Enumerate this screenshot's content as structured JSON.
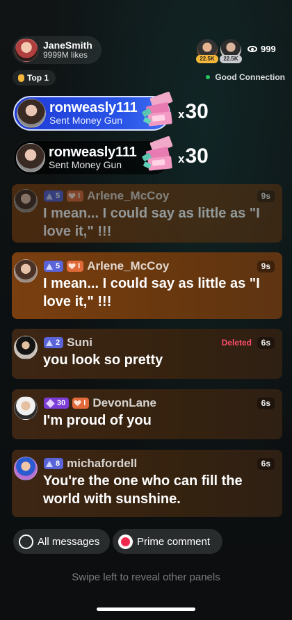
{
  "host": {
    "name": "JaneSmith",
    "likes": "9999M likes"
  },
  "viewers": {
    "badges": [
      "22.5K",
      "22.5K"
    ],
    "count": "999"
  },
  "rank": {
    "label": "Top 1"
  },
  "connection": {
    "label": "Good Connection",
    "color": "#22c55e"
  },
  "gifts": [
    {
      "user": "ronweasly111",
      "action": "Sent Money Gun",
      "x": "x",
      "count": "30"
    },
    {
      "user": "ronweasly111",
      "action": "Sent Money Gun",
      "x": "x",
      "count": "30"
    }
  ],
  "comments": [
    {
      "level": "5",
      "fan": "I",
      "name": "Arlene_McCoy",
      "time": "9s",
      "text": "I mean... I could say as little as \"I love it,\" !!!"
    },
    {
      "level": "5",
      "fan": "I",
      "name": "Arlene_McCoy",
      "time": "9s",
      "text": "I mean... I could say as little as \"I love it,\" !!!"
    },
    {
      "level": "2",
      "name": "Suni",
      "status": "Deleted",
      "time": "6s",
      "text": "you look so pretty"
    },
    {
      "diamond": "30",
      "fan": "I",
      "name": "DevonLane",
      "time": "6s",
      "text": "I'm proud of you"
    },
    {
      "level": "8",
      "name": "michafordell",
      "time": "6s",
      "text": "You're the one who can fill the world with sunshine."
    }
  ],
  "controls": {
    "all_messages": "All messages",
    "prime_comment": "Prime comment",
    "accent": "#f1284e"
  },
  "hint": "Swipe left to reveal other panels"
}
